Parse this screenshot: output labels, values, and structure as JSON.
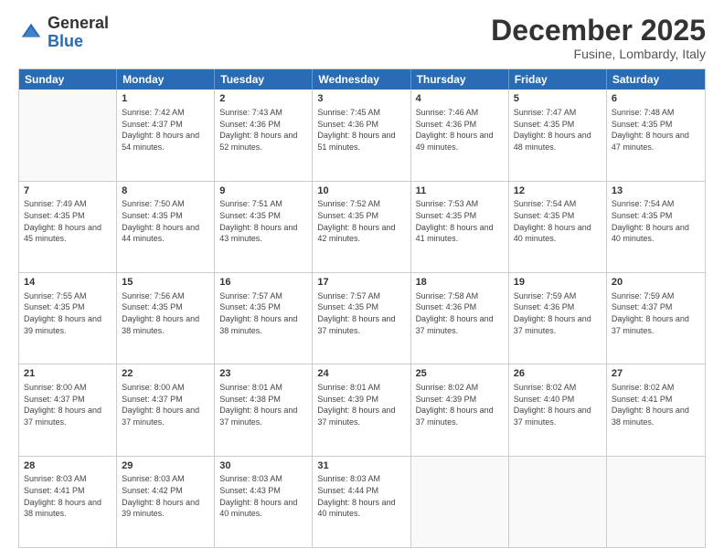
{
  "header": {
    "logo_general": "General",
    "logo_blue": "Blue",
    "month_title": "December 2025",
    "location": "Fusine, Lombardy, Italy"
  },
  "days_of_week": [
    "Sunday",
    "Monday",
    "Tuesday",
    "Wednesday",
    "Thursday",
    "Friday",
    "Saturday"
  ],
  "weeks": [
    [
      {
        "day": "",
        "info": ""
      },
      {
        "day": "1",
        "info": "Sunrise: 7:42 AM\nSunset: 4:37 PM\nDaylight: 8 hours\nand 54 minutes."
      },
      {
        "day": "2",
        "info": "Sunrise: 7:43 AM\nSunset: 4:36 PM\nDaylight: 8 hours\nand 52 minutes."
      },
      {
        "day": "3",
        "info": "Sunrise: 7:45 AM\nSunset: 4:36 PM\nDaylight: 8 hours\nand 51 minutes."
      },
      {
        "day": "4",
        "info": "Sunrise: 7:46 AM\nSunset: 4:36 PM\nDaylight: 8 hours\nand 49 minutes."
      },
      {
        "day": "5",
        "info": "Sunrise: 7:47 AM\nSunset: 4:35 PM\nDaylight: 8 hours\nand 48 minutes."
      },
      {
        "day": "6",
        "info": "Sunrise: 7:48 AM\nSunset: 4:35 PM\nDaylight: 8 hours\nand 47 minutes."
      }
    ],
    [
      {
        "day": "7",
        "info": "Sunrise: 7:49 AM\nSunset: 4:35 PM\nDaylight: 8 hours\nand 45 minutes."
      },
      {
        "day": "8",
        "info": "Sunrise: 7:50 AM\nSunset: 4:35 PM\nDaylight: 8 hours\nand 44 minutes."
      },
      {
        "day": "9",
        "info": "Sunrise: 7:51 AM\nSunset: 4:35 PM\nDaylight: 8 hours\nand 43 minutes."
      },
      {
        "day": "10",
        "info": "Sunrise: 7:52 AM\nSunset: 4:35 PM\nDaylight: 8 hours\nand 42 minutes."
      },
      {
        "day": "11",
        "info": "Sunrise: 7:53 AM\nSunset: 4:35 PM\nDaylight: 8 hours\nand 41 minutes."
      },
      {
        "day": "12",
        "info": "Sunrise: 7:54 AM\nSunset: 4:35 PM\nDaylight: 8 hours\nand 40 minutes."
      },
      {
        "day": "13",
        "info": "Sunrise: 7:54 AM\nSunset: 4:35 PM\nDaylight: 8 hours\nand 40 minutes."
      }
    ],
    [
      {
        "day": "14",
        "info": "Sunrise: 7:55 AM\nSunset: 4:35 PM\nDaylight: 8 hours\nand 39 minutes."
      },
      {
        "day": "15",
        "info": "Sunrise: 7:56 AM\nSunset: 4:35 PM\nDaylight: 8 hours\nand 38 minutes."
      },
      {
        "day": "16",
        "info": "Sunrise: 7:57 AM\nSunset: 4:35 PM\nDaylight: 8 hours\nand 38 minutes."
      },
      {
        "day": "17",
        "info": "Sunrise: 7:57 AM\nSunset: 4:35 PM\nDaylight: 8 hours\nand 37 minutes."
      },
      {
        "day": "18",
        "info": "Sunrise: 7:58 AM\nSunset: 4:36 PM\nDaylight: 8 hours\nand 37 minutes."
      },
      {
        "day": "19",
        "info": "Sunrise: 7:59 AM\nSunset: 4:36 PM\nDaylight: 8 hours\nand 37 minutes."
      },
      {
        "day": "20",
        "info": "Sunrise: 7:59 AM\nSunset: 4:37 PM\nDaylight: 8 hours\nand 37 minutes."
      }
    ],
    [
      {
        "day": "21",
        "info": "Sunrise: 8:00 AM\nSunset: 4:37 PM\nDaylight: 8 hours\nand 37 minutes."
      },
      {
        "day": "22",
        "info": "Sunrise: 8:00 AM\nSunset: 4:37 PM\nDaylight: 8 hours\nand 37 minutes."
      },
      {
        "day": "23",
        "info": "Sunrise: 8:01 AM\nSunset: 4:38 PM\nDaylight: 8 hours\nand 37 minutes."
      },
      {
        "day": "24",
        "info": "Sunrise: 8:01 AM\nSunset: 4:39 PM\nDaylight: 8 hours\nand 37 minutes."
      },
      {
        "day": "25",
        "info": "Sunrise: 8:02 AM\nSunset: 4:39 PM\nDaylight: 8 hours\nand 37 minutes."
      },
      {
        "day": "26",
        "info": "Sunrise: 8:02 AM\nSunset: 4:40 PM\nDaylight: 8 hours\nand 37 minutes."
      },
      {
        "day": "27",
        "info": "Sunrise: 8:02 AM\nSunset: 4:41 PM\nDaylight: 8 hours\nand 38 minutes."
      }
    ],
    [
      {
        "day": "28",
        "info": "Sunrise: 8:03 AM\nSunset: 4:41 PM\nDaylight: 8 hours\nand 38 minutes."
      },
      {
        "day": "29",
        "info": "Sunrise: 8:03 AM\nSunset: 4:42 PM\nDaylight: 8 hours\nand 39 minutes."
      },
      {
        "day": "30",
        "info": "Sunrise: 8:03 AM\nSunset: 4:43 PM\nDaylight: 8 hours\nand 40 minutes."
      },
      {
        "day": "31",
        "info": "Sunrise: 8:03 AM\nSunset: 4:44 PM\nDaylight: 8 hours\nand 40 minutes."
      },
      {
        "day": "",
        "info": ""
      },
      {
        "day": "",
        "info": ""
      },
      {
        "day": "",
        "info": ""
      }
    ]
  ]
}
